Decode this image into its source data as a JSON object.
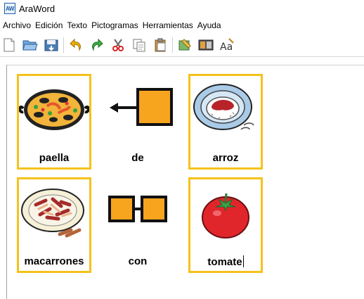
{
  "window": {
    "title": "AraWord",
    "app_icon_text": "AW"
  },
  "menu": [
    "Archivo",
    "Edición",
    "Texto",
    "Pictogramas",
    "Herramientas",
    "Ayuda"
  ],
  "toolbar": [
    "new-document-icon",
    "open-folder-icon",
    "save-icon",
    "undo-icon",
    "redo-icon",
    "cut-icon",
    "copy-icon",
    "paste-icon",
    "pictogram-edit-icon",
    "pictogram-display-icon",
    "text-style-icon"
  ],
  "colors": {
    "frame": "#f5c21b",
    "orange": "#f7a41f"
  },
  "cards": [
    {
      "word": "paella",
      "pictogram": "paella-pictogram",
      "framed": true
    },
    {
      "word": "de",
      "pictogram": "of-arrow-pictogram",
      "framed": false
    },
    {
      "word": "arroz",
      "pictogram": "rice-plate-pictogram",
      "framed": true
    },
    {
      "word": "macarrones",
      "pictogram": "macaroni-plate-pictogram",
      "framed": true
    },
    {
      "word": "con",
      "pictogram": "with-link-pictogram",
      "framed": false
    },
    {
      "word": "tomate",
      "pictogram": "tomato-pictogram",
      "framed": true
    }
  ]
}
